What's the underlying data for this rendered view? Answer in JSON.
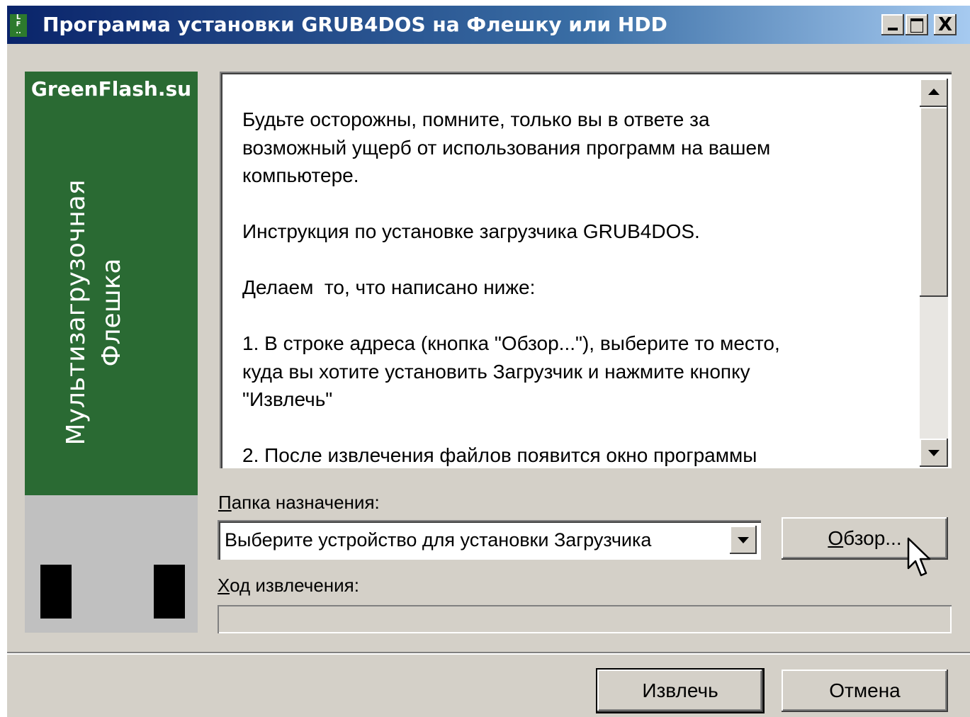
{
  "window": {
    "title": "Программа установки GRUB4DOS на Флешку или HDD",
    "icon": "app-icon",
    "controls": [
      "minimize-icon",
      "maximize-icon",
      "close-icon"
    ],
    "close_glyph": "X"
  },
  "sidebar": {
    "brand": "GreenFlash.su",
    "vertical_lines": [
      "Мультизагрузочная",
      "Флешка"
    ],
    "colors": {
      "green": "#2a6a33",
      "grey": "#c0c0c0",
      "pins": "#000000"
    }
  },
  "info": {
    "text": "Будьте осторожны, помните, только вы в ответе за\nвозможный ущерб от использования программ на вашем\nкомпьютере.\n\nИнструкция по установке загрузчика GRUB4DOS.\n\nДелаем  то, что написано ниже:\n\n1. В строке адреса (кнопка \"Обзор...\"), выберите то место,\nкуда вы хотите установить Загрузчик и нажмите кнопку\n\"Извлечь\"\n\n2. После извлечения файлов появится окно программы"
  },
  "destination": {
    "label_prefix": "П",
    "label_rest": "апка назначения:",
    "value": "Выберите устройство для установки Загрузчика"
  },
  "browse": {
    "prefix": "О",
    "rest": "бзор..."
  },
  "progress": {
    "label_prefix": "Х",
    "label_rest": "од извлечения:",
    "value": 0
  },
  "buttons": {
    "extract": "Извлечь",
    "cancel": "Отмена"
  },
  "colors": {
    "titlebar": "#0a246a",
    "face": "#d4d0c8"
  }
}
